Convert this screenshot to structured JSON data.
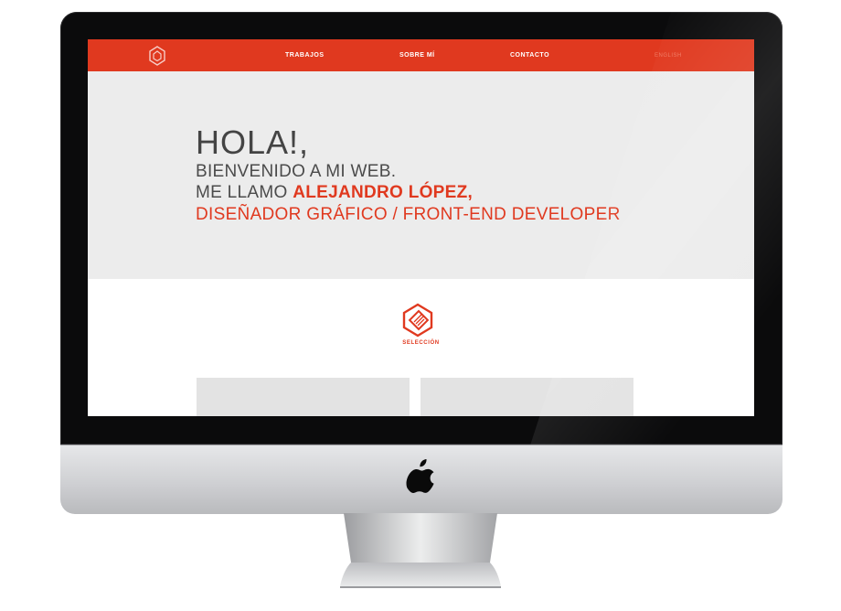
{
  "nav": {
    "items": [
      "TRABAJOS",
      "SOBRE MÍ",
      "CONTACTO"
    ],
    "language": "ENGLISH"
  },
  "hero": {
    "greeting": "HOLA!,",
    "welcome": "BIENVENIDO A MI WEB.",
    "name_prefix": "ME LLAMO",
    "name": "ALEJANDRO LÓPEZ,",
    "role": "DISEÑADOR GRÁFICO / FRONT-END DEVELOPER"
  },
  "section": {
    "label": "SELECCIÓN"
  },
  "colors": {
    "accent": "#e0391f",
    "hero_bg": "#ececec",
    "section_bg": "#ffffff"
  }
}
